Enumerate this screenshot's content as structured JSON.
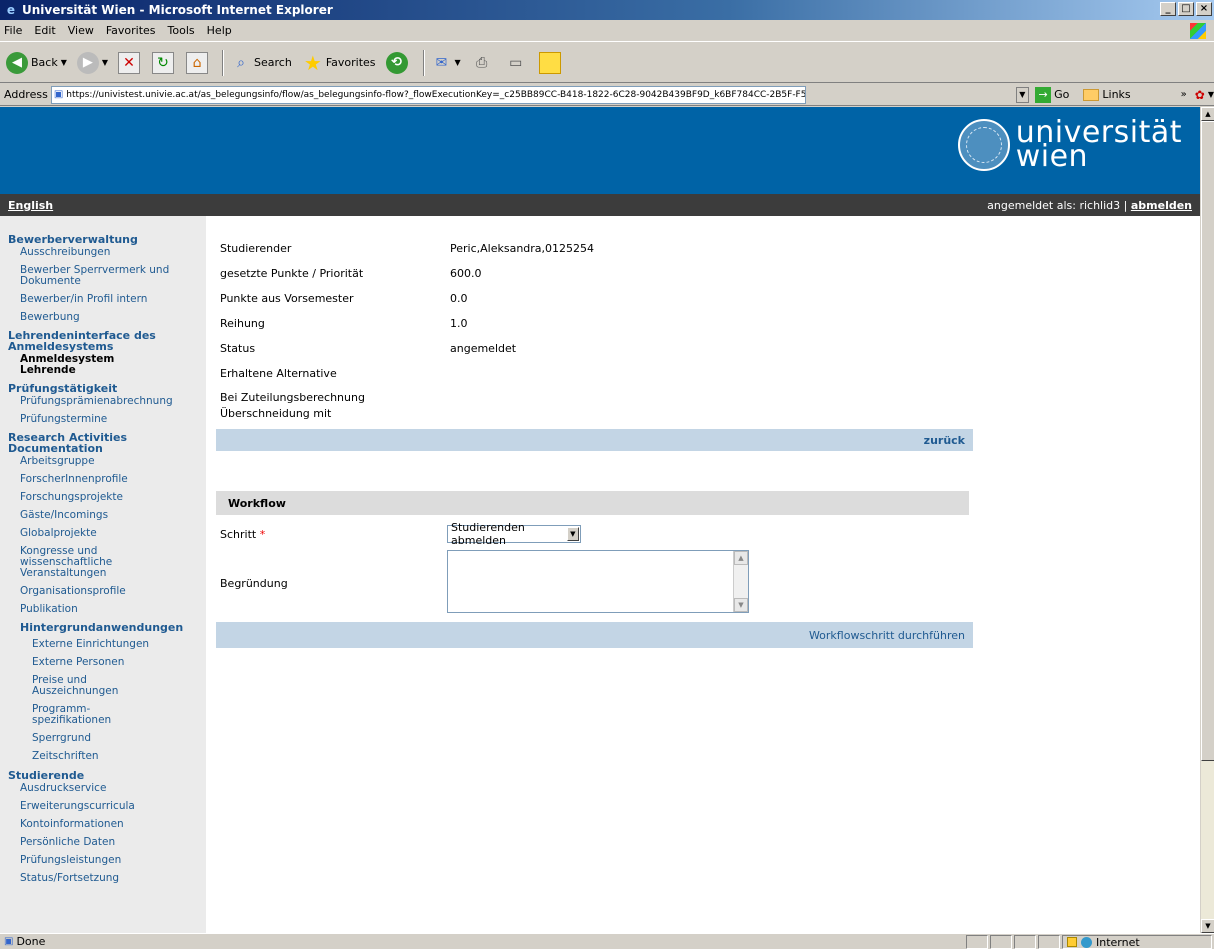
{
  "window": {
    "title": "Universität Wien - Microsoft Internet Explorer",
    "controls": [
      "_",
      "□",
      "×"
    ]
  },
  "menu": [
    "File",
    "Edit",
    "View",
    "Favorites",
    "Tools",
    "Help"
  ],
  "toolbar": {
    "back_label": "Back",
    "search_label": "Search",
    "favorites_label": "Favorites"
  },
  "address": {
    "label": "Address",
    "url": "https://univistest.univie.ac.at/as_belegungsinfo/flow/as_belegungsinfo-flow?_flowExecutionKey=_c25BB89CC-B418-1822-6C28-9042B439BF9D_k6BF784CC-2B5F-F577-6916-C1A380A2966E",
    "go_label": "Go",
    "links_label": "Links"
  },
  "header": {
    "logo_line1": "universität",
    "logo_line2": "wien",
    "language_link": "English",
    "user_prefix": "angemeldet als: richlid3 |",
    "logout_link": "abmelden"
  },
  "sidebar": {
    "sections": [
      {
        "title": "Bewerberverwaltung",
        "items": [
          "Ausschreibungen",
          "Bewerber Sperrvermerk und Dokumente",
          "Bewerber/in Profil intern",
          "Bewerbung"
        ]
      },
      {
        "title": "Lehrendeninterface des Anmeldesystems",
        "items": [
          "Anmeldesystem Lehrende"
        ]
      },
      {
        "title": "Prüfungstätigkeit",
        "items": [
          "Prüfungsprämienabrechnung",
          "Prüfungstermine"
        ]
      },
      {
        "title": "Research Activities Documentation",
        "items": [
          "Arbeitsgruppe",
          "ForscherInnenprofile",
          "Forschungsprojekte",
          "Gäste/Incomings",
          "Globalprojekte",
          "Kongresse und wissenschaftliche Veranstaltungen",
          "Organisationsprofile",
          "Publikation"
        ],
        "subheading": "Hintergrundanwendungen",
        "subitems": [
          "Externe Einrichtungen",
          "Externe Personen",
          "Preise und Auszeichnungen",
          "Programm-spezifikationen",
          "Sperrgrund",
          "Zeitschriften"
        ]
      },
      {
        "title": "Studierende",
        "items": [
          "Ausdruckservice",
          "Erweiterungscurricula",
          "Kontoinformationen",
          "Persönliche Daten",
          "Prüfungsleistungen",
          "Status/Fortsetzung"
        ]
      }
    ]
  },
  "details": {
    "rows": [
      {
        "label": "Studierender",
        "value": "Peric,Aleksandra,0125254"
      },
      {
        "label": "gesetzte Punkte / Priorität",
        "value": "600.0"
      },
      {
        "label": "Punkte aus Vorsemester",
        "value": "0.0"
      },
      {
        "label": "Reihung",
        "value": "1.0"
      },
      {
        "label": "Status",
        "value": "angemeldet"
      },
      {
        "label": "Erhaltene Alternative",
        "value": ""
      },
      {
        "label": "Bei Zuteilungsberechnung Überschneidung mit",
        "value": ""
      }
    ],
    "back_link": "zurück"
  },
  "workflow": {
    "title": "Workflow",
    "step_label": "Schritt",
    "required_marker": "*",
    "step_value": "Studierenden abmelden",
    "reason_label": "Begründung",
    "reason_value": "",
    "submit_link": "Workflowschritt durchführen"
  },
  "status": {
    "text": "Done",
    "zone": "Internet"
  }
}
